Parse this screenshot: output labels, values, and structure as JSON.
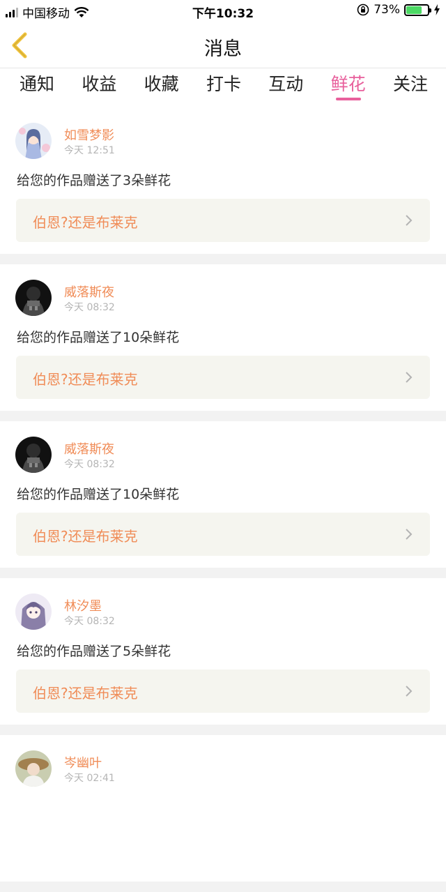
{
  "status_bar": {
    "carrier": "中国移动",
    "time": "下午10:32",
    "battery_percent": "73%",
    "battery_level": 0.73,
    "battery_color": "#4cd964"
  },
  "nav": {
    "title": "消息",
    "back_icon": "chevron-left-icon",
    "back_color": "#f0c33c"
  },
  "tabs": [
    {
      "label": "通知",
      "active": false
    },
    {
      "label": "收益",
      "active": false
    },
    {
      "label": "收藏",
      "active": false
    },
    {
      "label": "打卡",
      "active": false
    },
    {
      "label": "互动",
      "active": false
    },
    {
      "label": "鲜花",
      "active": true
    },
    {
      "label": "关注",
      "active": false
    }
  ],
  "accent_color": "#e8609c",
  "name_color": "#f08c57",
  "messages": [
    {
      "username": "如雪梦影",
      "time": "今天 12:51",
      "text": "给您的作品赠送了3朵鲜花",
      "work_title": "伯恩?还是布莱克",
      "avatar": "anime-girl-avatar"
    },
    {
      "username": "威落斯夜",
      "time": "今天 08:32",
      "text": "给您的作品赠送了10朵鲜花",
      "work_title": "伯恩?还是布莱克",
      "avatar": "dark-figure-avatar"
    },
    {
      "username": "威落斯夜",
      "time": "今天 08:32",
      "text": "给您的作品赠送了10朵鲜花",
      "work_title": "伯恩?还是布莱克",
      "avatar": "dark-figure-avatar"
    },
    {
      "username": "林汐墨",
      "time": "今天 08:32",
      "text": "给您的作品赠送了5朵鲜花",
      "work_title": "伯恩?还是布莱克",
      "avatar": "anime-girl-purple-avatar"
    },
    {
      "username": "岑幽叶",
      "time": "今天 02:41",
      "text": "",
      "work_title": "",
      "avatar": "girl-hat-avatar"
    }
  ]
}
